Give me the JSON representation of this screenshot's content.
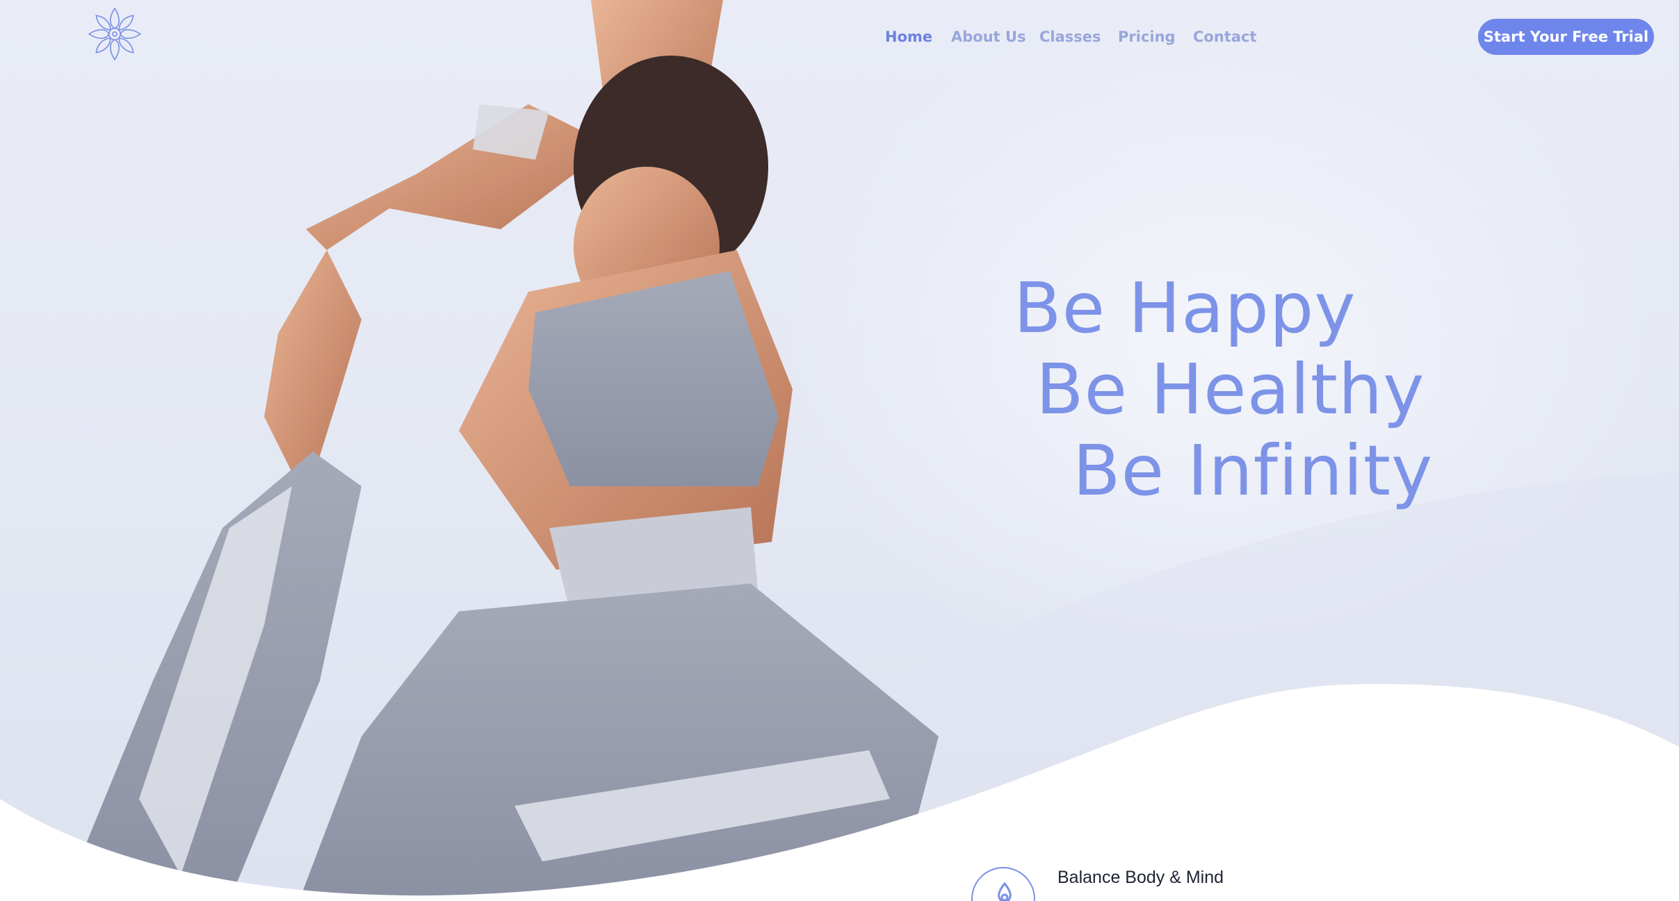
{
  "brand": {
    "logo_icon": "lotus-mandala-icon",
    "accent_color": "#6e86eb"
  },
  "nav": {
    "items": [
      {
        "label": "Home",
        "active": true
      },
      {
        "label": "About Us",
        "active": false
      },
      {
        "label": "Classes",
        "active": false
      },
      {
        "label": "Pricing",
        "active": false
      },
      {
        "label": "Contact",
        "active": false
      }
    ],
    "cta_label": "Start Your Free Trial"
  },
  "hero": {
    "line1": "Be Happy",
    "line2": "Be Healthy",
    "line3": "Be Infinity",
    "text_color": "#7d93e8"
  },
  "features": {
    "first_title": "Balance Body & Mind",
    "first_icon": "lotus-drop-icon"
  }
}
